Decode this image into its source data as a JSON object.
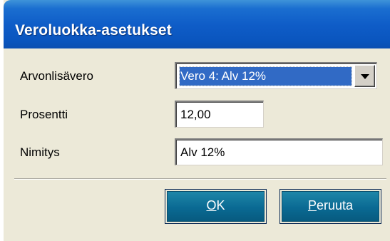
{
  "dialog": {
    "title": "Veroluokka-asetukset",
    "colors": {
      "title_bar": "#0b5ac6",
      "selection": "#316ac5",
      "button_face": "#0a6a93",
      "dialog_bg": "#ece9d8"
    }
  },
  "fields": {
    "vat_label": "Arvonlisävero",
    "vat_selected": "Vero 4: Alv 12%",
    "percent_label": "Prosentti",
    "percent_value": "12,00",
    "name_label": "Nimitys",
    "name_value": "Alv 12%"
  },
  "buttons": {
    "ok": {
      "accel": "O",
      "rest": "K"
    },
    "cancel": {
      "accel": "P",
      "rest": "eruuta"
    }
  },
  "icons": {
    "dropdown": "chevron-down-icon"
  }
}
